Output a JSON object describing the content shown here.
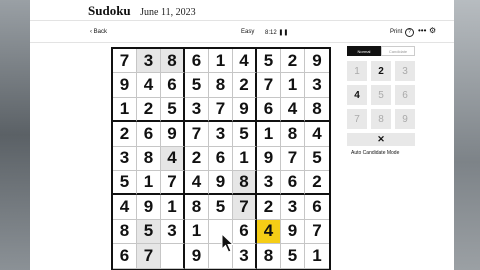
{
  "header": {
    "title": "Sudoku",
    "date": "June 11, 2023"
  },
  "toolbar": {
    "back_label": "‹ Back",
    "level": "Easy",
    "timer": "8:12 ❚❚",
    "print_label": "Print",
    "help_icon": "?",
    "more_icon": "•••",
    "settings_icon": "⚙"
  },
  "grid": {
    "rows": [
      [
        "7",
        "3",
        "8",
        "6",
        "1",
        "4",
        "5",
        "2",
        "9"
      ],
      [
        "9",
        "4",
        "6",
        "5",
        "8",
        "2",
        "7",
        "1",
        "3"
      ],
      [
        "1",
        "2",
        "5",
        "3",
        "7",
        "9",
        "6",
        "4",
        "8"
      ],
      [
        "2",
        "6",
        "9",
        "7",
        "3",
        "5",
        "1",
        "8",
        "4"
      ],
      [
        "3",
        "8",
        "4",
        "2",
        "6",
        "1",
        "9",
        "7",
        "5"
      ],
      [
        "5",
        "1",
        "7",
        "4",
        "9",
        "8",
        "3",
        "6",
        "2"
      ],
      [
        "4",
        "9",
        "1",
        "8",
        "5",
        "7",
        "2",
        "3",
        "6"
      ],
      [
        "8",
        "5",
        "3",
        "1",
        "",
        "6",
        "4",
        "9",
        "7"
      ],
      [
        "6",
        "7",
        "",
        "9",
        "",
        "3",
        "8",
        "5",
        "1"
      ]
    ],
    "given": [
      [
        0,
        1,
        1,
        0,
        0,
        0,
        0,
        0,
        0
      ],
      [
        0,
        0,
        0,
        0,
        0,
        0,
        0,
        0,
        0
      ],
      [
        0,
        0,
        0,
        0,
        0,
        0,
        0,
        0,
        0
      ],
      [
        0,
        0,
        0,
        0,
        0,
        0,
        0,
        0,
        0
      ],
      [
        0,
        0,
        1,
        0,
        0,
        0,
        0,
        0,
        0
      ],
      [
        0,
        0,
        0,
        0,
        0,
        1,
        0,
        0,
        0
      ],
      [
        0,
        0,
        0,
        0,
        0,
        1,
        0,
        0,
        0
      ],
      [
        0,
        1,
        0,
        0,
        0,
        0,
        0,
        0,
        0
      ],
      [
        0,
        1,
        0,
        0,
        0,
        0,
        0,
        0,
        0
      ]
    ],
    "selected_cell": {
      "row": 7,
      "col": 6
    },
    "selected_color": "#f5cd16"
  },
  "panel": {
    "modes": [
      "Normal",
      "Candidate"
    ],
    "active_mode": "Normal",
    "keypad": [
      {
        "label": "1",
        "enabled": false
      },
      {
        "label": "2",
        "enabled": true
      },
      {
        "label": "3",
        "enabled": false
      },
      {
        "label": "4",
        "enabled": true
      },
      {
        "label": "5",
        "enabled": false
      },
      {
        "label": "6",
        "enabled": false
      },
      {
        "label": "7",
        "enabled": false
      },
      {
        "label": "8",
        "enabled": false
      },
      {
        "label": "9",
        "enabled": false
      }
    ],
    "erase_label": "✕",
    "auto_candidate_label": "Auto Candidate Mode"
  }
}
